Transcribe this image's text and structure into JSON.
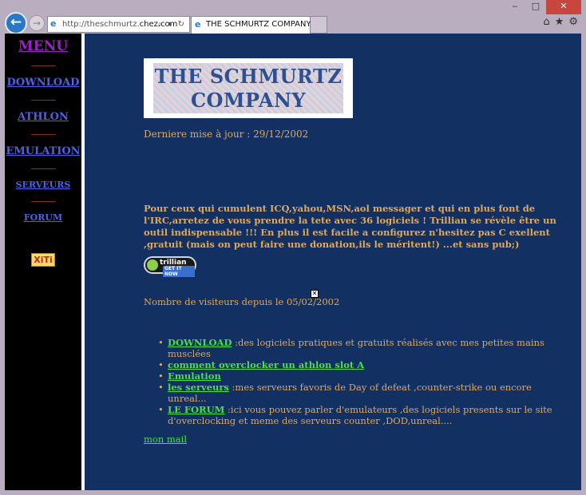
{
  "browser": {
    "address_prefix": "http://theschmurtz.",
    "address_domain": "chez.com",
    "address_controls": "⌕ ▾ ↻",
    "tab_title": "THE SCHMURTZ COMPANY",
    "back_icon": "arrow-left-icon",
    "forward_icon": "arrow-right-icon",
    "window_controls": {
      "minimize": "‒",
      "maximize": "□",
      "close": "✕"
    },
    "right_icons": {
      "home": "⌂",
      "favorites": "★",
      "settings": "⚙"
    }
  },
  "sidebar": {
    "title": "MENU",
    "separator": "---------------",
    "items": [
      {
        "label": "DOWNLOAD",
        "small": false
      },
      {
        "label": "ATHLON",
        "small": false
      },
      {
        "label": "EMULATION",
        "small": false
      },
      {
        "label": "SERVEURS",
        "small": true
      },
      {
        "label": "FORUM",
        "small": true
      }
    ],
    "badge": "XiTi"
  },
  "main": {
    "logo_line1": "THE SCHMURTZ",
    "logo_line2": "COMPANY",
    "last_update": "Derniere mise à jour : 29/12/2002",
    "intro": "Pour ceux qui cumulent ICQ,yahou,MSN,aol messager et qui en plus font de l'IRC,arretez de vous prendre la tete avec 36 logiciels ! Trillian se révèle être un outil indispensable !!! En plus il est facile a configurez n'hesitez pas C exellent ,gratuit (mais on peut faire une donation,ils le méritent!) ...et sans pub;)",
    "trillian_badge": {
      "name": "trillian",
      "cta": "GET IT NOW"
    },
    "visitors": "Nombre de visiteurs depuis le 05/02/2002",
    "links": [
      {
        "link": "DOWNLOAD",
        "text": " :des logiciels pratiques et gratuits réalisés avec mes petites mains musclées"
      },
      {
        "link": "comment overclocker un athlon slot A",
        "text": ""
      },
      {
        "link": "Emulation",
        "text": ""
      },
      {
        "link": "les serveurs",
        "text": " :mes serveurs favoris de Day of defeat ,counter-strike ou encore unreal..."
      },
      {
        "link": "LE FORUM",
        "text": " :ici vous pouvez parler d'emulateurs ,des logiciels presents sur le site d'overclocking et meme des serveurs counter ,DOD,unreal...."
      }
    ],
    "mail_link": "mon mail"
  },
  "colors": {
    "page_bg": "#123061",
    "sidebar_bg": "#000000",
    "text_orange": "#e2a85a",
    "link_green": "#47e047",
    "sidebar_link": "#4b62e6",
    "menu_purple": "#9c20c4"
  }
}
